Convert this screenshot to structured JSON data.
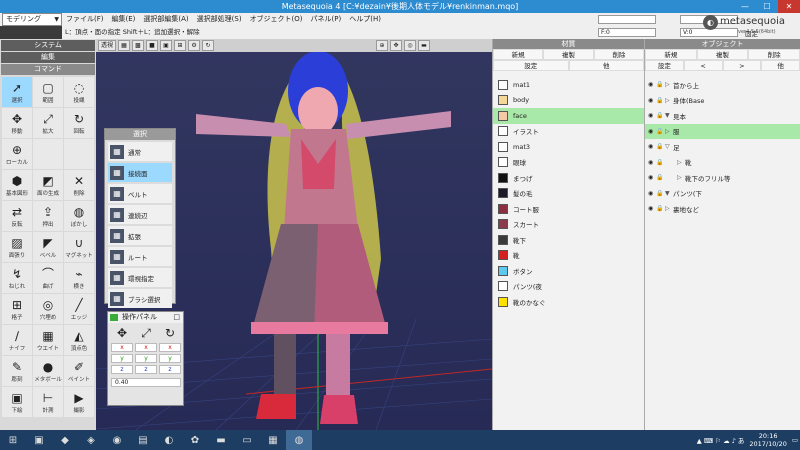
{
  "window": {
    "title": "Metasequoia 4 [C:¥dezain¥後期人体モデル¥renkinman.mqo]",
    "minimize": "—",
    "maximize": "☐",
    "close": "✕"
  },
  "mode": {
    "selected": "モデリング"
  },
  "menu": [
    "ファイル(F)",
    "編集(E)",
    "選択部編集(A)",
    "選択部処理(S)",
    "オブジェクト(O)",
    "パネル(P)",
    "ヘルプ(H)"
  ],
  "hint": "L：頂点・面の指定 Shift＋L：追加選択・解除",
  "status": {
    "f": "F:0",
    "v": "V:0",
    "fixed": "固定"
  },
  "brand": {
    "logo": "metasequoia",
    "version": "ver4.5.5(64bit)"
  },
  "viewport": {
    "view_label": "透視"
  },
  "left_sections": {
    "system": "システム",
    "edit": "編集",
    "command": "コマンド"
  },
  "tools": [
    {
      "label": "選択",
      "icon": "cursor-icon"
    },
    {
      "label": "範囲",
      "icon": "rect-select-icon"
    },
    {
      "label": "投縄",
      "icon": "lasso-icon"
    },
    {
      "label": "移動",
      "icon": "move-icon"
    },
    {
      "label": "拡大",
      "icon": "scale-icon"
    },
    {
      "label": "回転",
      "icon": "rotate-icon"
    },
    {
      "label": "ローカル",
      "icon": "local-icon"
    },
    {
      "label": "",
      "icon": ""
    },
    {
      "label": "",
      "icon": ""
    },
    {
      "label": "基本図形",
      "icon": "primitive-icon"
    },
    {
      "label": "面の生成",
      "icon": "face-gen-icon"
    },
    {
      "label": "削除",
      "icon": "delete-icon"
    },
    {
      "label": "反転",
      "icon": "flip-icon"
    },
    {
      "label": "押出",
      "icon": "extrude-icon"
    },
    {
      "label": "ぼかし",
      "icon": "blur-icon"
    },
    {
      "label": "面張り",
      "icon": "face-fill-icon"
    },
    {
      "label": "ベベル",
      "icon": "bevel-icon"
    },
    {
      "label": "マグネット",
      "icon": "magnet-icon"
    },
    {
      "label": "ねじれ",
      "icon": "twist-icon"
    },
    {
      "label": "曲げ",
      "icon": "bend-icon"
    },
    {
      "label": "横き",
      "icon": "knife-icon"
    },
    {
      "label": "格子",
      "icon": "lattice-icon"
    },
    {
      "label": "穴埋め",
      "icon": "hole-fill-icon"
    },
    {
      "label": "エッジ",
      "icon": "edge-icon"
    },
    {
      "label": "ナイフ",
      "icon": "knife2-icon"
    },
    {
      "label": "ウエイト",
      "icon": "weight-icon"
    },
    {
      "label": "頂点色",
      "icon": "vertex-color-icon"
    },
    {
      "label": "彫刻",
      "icon": "sculpt-icon"
    },
    {
      "label": "メタボール",
      "icon": "metaball-icon"
    },
    {
      "label": "ペイント",
      "icon": "paint-icon"
    },
    {
      "label": "下絵",
      "icon": "underlay-icon"
    },
    {
      "label": "計測",
      "icon": "measure-icon"
    },
    {
      "label": "撮影",
      "icon": "camera-icon"
    }
  ],
  "select_popup": {
    "title": "選択",
    "items": [
      "通常",
      "接続面",
      "ベルト",
      "連続辺",
      "拡張",
      "ルート",
      "環視指定",
      "ブラシ選択"
    ]
  },
  "op_panel": {
    "title": "操作パネル",
    "x": "x",
    "y": "y",
    "z": "z",
    "value": "0.40"
  },
  "materials": {
    "title": "材質",
    "buttons": [
      "新規",
      "複製",
      "削除"
    ],
    "buttons2": [
      "設定",
      "他"
    ],
    "items": [
      {
        "name": "mat1",
        "color": "#ffffff"
      },
      {
        "name": "body",
        "color": "#f5d79a"
      },
      {
        "name": "face",
        "color": "#f5c9a6"
      },
      {
        "name": "イラスト",
        "color": "#ffffff"
      },
      {
        "name": "mat3",
        "color": "#ffffff"
      },
      {
        "name": "眼球",
        "color": "#ffffff"
      },
      {
        "name": "まつげ",
        "color": "#111111"
      },
      {
        "name": "髪の毛",
        "color": "#1a1a2a"
      },
      {
        "name": "コート服",
        "color": "#8c2f3f"
      },
      {
        "name": "スカート",
        "color": "#8c3a4c"
      },
      {
        "name": "靴下",
        "color": "#3a3a3a"
      },
      {
        "name": "靴",
        "color": "#d42020"
      },
      {
        "name": "ボタン",
        "color": "#5fc8ee"
      },
      {
        "name": "パンツ(夜",
        "color": "#ffffff"
      },
      {
        "name": "靴のかなぐ",
        "color": "#ffe100"
      }
    ],
    "selected": 2
  },
  "objects": {
    "title": "オブジェクト",
    "buttons": [
      "新規",
      "複製",
      "削除"
    ],
    "buttons2": [
      "設定",
      "<",
      ">",
      "他"
    ],
    "items": [
      {
        "name": "首から上",
        "indent": 0,
        "tri": "▷"
      },
      {
        "name": "身体(Base",
        "indent": 0,
        "tri": "▷"
      },
      {
        "name": "見本",
        "indent": 0,
        "tri": "▼"
      },
      {
        "name": "服",
        "indent": 0,
        "tri": "▷"
      },
      {
        "name": "足",
        "indent": 0,
        "tri": "▽"
      },
      {
        "name": "靴",
        "indent": 1,
        "tri": "▷"
      },
      {
        "name": "靴下のフリル等",
        "indent": 1,
        "tri": "▷"
      },
      {
        "name": "パンツ(下",
        "indent": 0,
        "tri": "▼"
      },
      {
        "name": "裏地など",
        "indent": 0,
        "tri": "▷"
      }
    ],
    "selected": 3
  },
  "taskbar": {
    "time": "20:16",
    "date": "2017/10/20"
  }
}
